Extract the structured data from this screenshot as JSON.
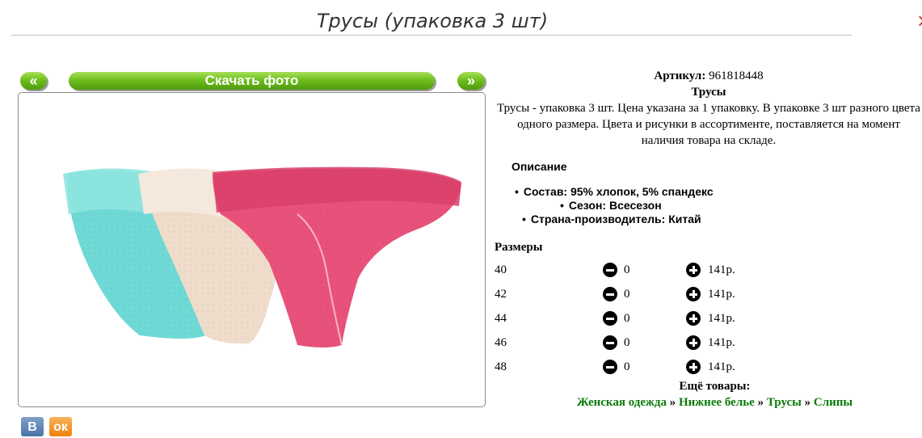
{
  "page": {
    "title": "Трусы (упаковка 3 шт)",
    "corner_glyph": "×"
  },
  "gallery": {
    "prev_label": "«",
    "next_label": "»",
    "download_label": "Скачать фото",
    "image_desc": "three lace panties: turquoise, beige, pink"
  },
  "product": {
    "sku_label": "Артикул:",
    "sku_value": "961818448",
    "name": "Трусы",
    "description": "Трусы - упаковка 3 шт. Цена указана за 1 упаковку. В упаковке 3 шт разного цвета одного размера. Цвета и рисунки в ассортименте, поставляется на момент наличия товара на складе."
  },
  "specs": {
    "heading": "Описание",
    "items": [
      "Состав: 95% хлопок, 5% спандекс",
      "Сезон: Всесезон",
      "Страна-производитель: Китай"
    ]
  },
  "sizes": {
    "heading": "Размеры",
    "rows": [
      {
        "size": "40",
        "qty": "0",
        "price": "141р."
      },
      {
        "size": "42",
        "qty": "0",
        "price": "141р."
      },
      {
        "size": "44",
        "qty": "0",
        "price": "141р."
      },
      {
        "size": "46",
        "qty": "0",
        "price": "141р."
      },
      {
        "size": "48",
        "qty": "0",
        "price": "141р."
      }
    ]
  },
  "more": {
    "heading": "Ещё товары:",
    "crumbs": [
      "Женская одежда",
      "Нижнее белье",
      "Трусы",
      "Слипы"
    ],
    "separator": "»"
  },
  "social": {
    "vk_label": "В",
    "ok_label": "ок"
  },
  "colors": {
    "accent_green": "#6fbf1e",
    "link_green": "#0a7a0a",
    "panty_teal": "#6fd9d6",
    "panty_beige": "#efdccb",
    "panty_pink": "#e8527a"
  }
}
